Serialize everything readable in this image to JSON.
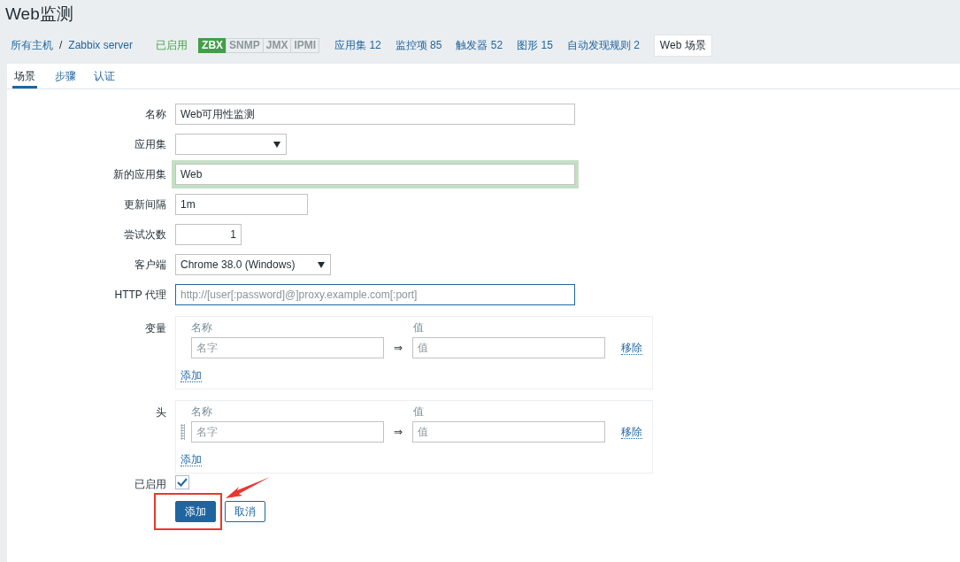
{
  "page": {
    "title": "Web监测"
  },
  "nav": {
    "crumbs": [
      {
        "label": "所有主机"
      },
      {
        "label": "Zabbix server"
      }
    ],
    "separator": "/",
    "status": {
      "label": "已启用",
      "enabled": true
    },
    "availability": [
      {
        "label": "ZBX",
        "on": true
      },
      {
        "label": "SNMP",
        "on": false
      },
      {
        "label": "JMX",
        "on": false
      },
      {
        "label": "IPMI",
        "on": false
      }
    ],
    "links": [
      {
        "label": "应用集",
        "count": "12",
        "selected": false
      },
      {
        "label": "监控项",
        "count": "85",
        "selected": false
      },
      {
        "label": "触发器",
        "count": "52",
        "selected": false
      },
      {
        "label": "图形",
        "count": "15",
        "selected": false
      },
      {
        "label": "自动发现规则",
        "count": "2",
        "selected": false
      },
      {
        "label": "Web 场景",
        "selected": true
      }
    ]
  },
  "tabs": [
    {
      "label": "场景",
      "selected": true
    },
    {
      "label": "步骤",
      "selected": false
    },
    {
      "label": "认证",
      "selected": false
    }
  ],
  "form": {
    "rows": [
      {
        "kind": "text",
        "label": "名称",
        "value": "Web可用性监测",
        "highlighted": false,
        "focused": false
      },
      {
        "kind": "select",
        "label": "应用集"
      },
      {
        "kind": "text",
        "label": "新的应用集",
        "value": "Web",
        "highlighted": true,
        "focused": false
      },
      {
        "kind": "medium",
        "label": "更新间隔",
        "value": "1m"
      },
      {
        "kind": "number",
        "label": "尝试次数",
        "value": "1"
      },
      {
        "kind": "select",
        "label": "客户端",
        "value": "Chrome 38.0 (Windows)"
      },
      {
        "kind": "text",
        "label": "HTTP 代理",
        "placeholder": "http://[user[:password]@]proxy.example.com[:port]",
        "highlighted": false,
        "focused": true
      },
      {
        "kind": "pairs",
        "label": "变量",
        "name_header": "名称",
        "value_header": "值",
        "rows": [
          {
            "name_placeholder": "名字",
            "arrow": "⇒",
            "value_placeholder": "值",
            "remove": "移除",
            "draggable": false
          }
        ],
        "add": "添加"
      },
      {
        "kind": "pairs",
        "label": "头",
        "name_header": "名称",
        "value_header": "值",
        "rows": [
          {
            "name_placeholder": "名字",
            "arrow": "⇒",
            "value_placeholder": "值",
            "remove": "移除",
            "draggable": true
          }
        ],
        "add": "添加"
      },
      {
        "kind": "checkbox",
        "label": "已启用",
        "checked": true
      }
    ],
    "buttons": [
      {
        "label": "添加",
        "primary": true,
        "annotated": true
      },
      {
        "label": "取消",
        "primary": false,
        "annotated": false
      }
    ]
  }
}
